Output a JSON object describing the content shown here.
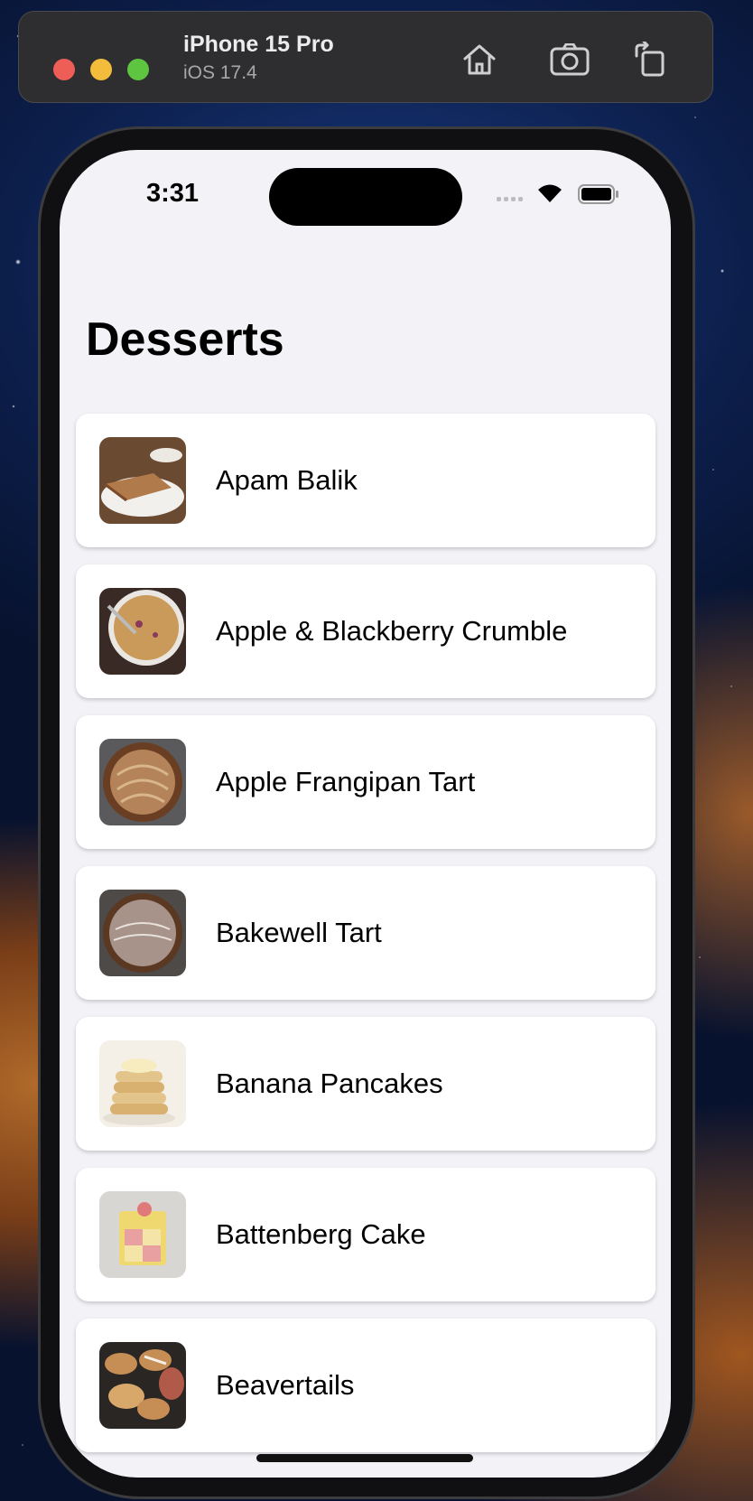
{
  "simulator": {
    "device_name": "iPhone 15 Pro",
    "os_version": "iOS 17.4",
    "buttons": [
      {
        "icon": "home-icon"
      },
      {
        "icon": "screenshot-icon"
      },
      {
        "icon": "rotate-icon"
      }
    ]
  },
  "status_bar": {
    "time": "3:31",
    "icons": [
      "cellular-signal-icon",
      "wifi-icon",
      "battery-icon"
    ]
  },
  "screen": {
    "title": "Desserts",
    "items": [
      {
        "label": "Apam Balik",
        "thumb_color": "#b07a4a"
      },
      {
        "label": "Apple & Blackberry Crumble",
        "thumb_color": "#c99a5a"
      },
      {
        "label": "Apple Frangipan Tart",
        "thumb_color": "#9a6a45"
      },
      {
        "label": "Bakewell Tart",
        "thumb_color": "#8c7a6a"
      },
      {
        "label": "Banana Pancakes",
        "thumb_color": "#e3c48a"
      },
      {
        "label": "Battenberg Cake",
        "thumb_color": "#f0d870"
      },
      {
        "label": "Beavertails",
        "thumb_color": "#c68e55"
      }
    ]
  },
  "colors": {
    "background": "#f2f2f7",
    "card": "#ffffff",
    "text": "#000000",
    "toolbar": "#2e2e31"
  }
}
